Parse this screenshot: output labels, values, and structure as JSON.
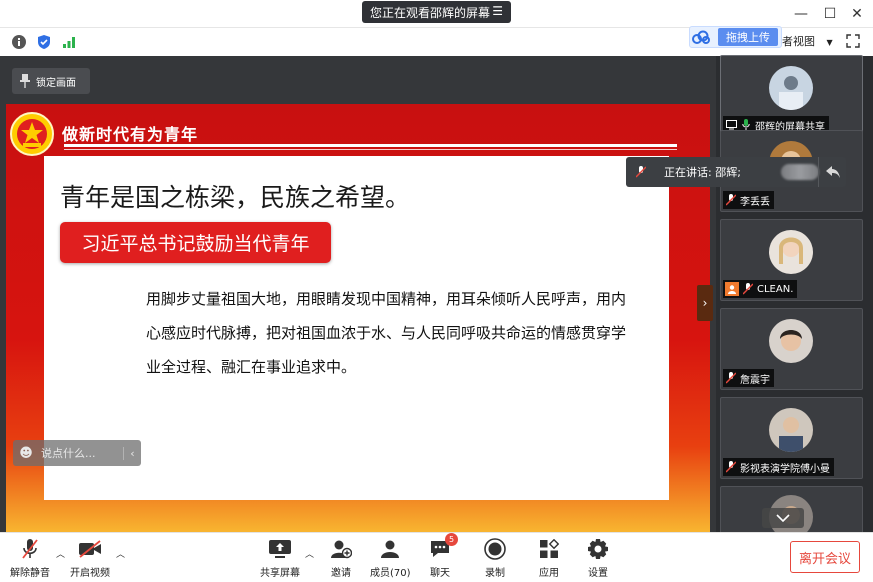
{
  "titlebar": {
    "viewing_label": "您正在观看邵辉的屏幕",
    "menu_icon": "hamburger-icon",
    "window_controls": [
      "minimize",
      "maximize",
      "close"
    ]
  },
  "infobar": {
    "upload_label": "拖拽上传",
    "view_label": "者视图"
  },
  "main": {
    "lock_label": "锁定画面",
    "chat_placeholder": "说点什么..."
  },
  "slide": {
    "header": "做新时代有为青年",
    "title": "青年是国之栋梁，民族之希望。",
    "red_label": "习近平总书记鼓励当代青年",
    "body": "用脚步丈量祖国大地，用眼睛发现中国精神，用耳朵倾听人民呼声，用内心感应时代脉搏，把对祖国血浓于水、与人民同呼吸共命运的情感贯穿学业全过程、融汇在事业追求中。",
    "colors": {
      "red": "#d7140f",
      "accent": "#e01f1f",
      "gold": "#f8b530"
    }
  },
  "speaking": {
    "label": "正在讲话: 邵辉;"
  },
  "participants": [
    {
      "name": "邵辉的屏幕共享",
      "active": true
    },
    {
      "name": "李丢丢"
    },
    {
      "name": "CLEAN."
    },
    {
      "name": "詹震宇"
    },
    {
      "name": "影视表演学院傅小曼"
    }
  ],
  "toolbar": {
    "unmute": "解除静音",
    "start_video": "开启视频",
    "share_screen": "共享屏幕",
    "invite": "邀请",
    "members": "成员(70)",
    "chat": "聊天",
    "chat_badge": "5",
    "record": "录制",
    "apps": "应用",
    "settings": "设置",
    "leave": "离开会议",
    "leave_color": "#e6483d"
  }
}
